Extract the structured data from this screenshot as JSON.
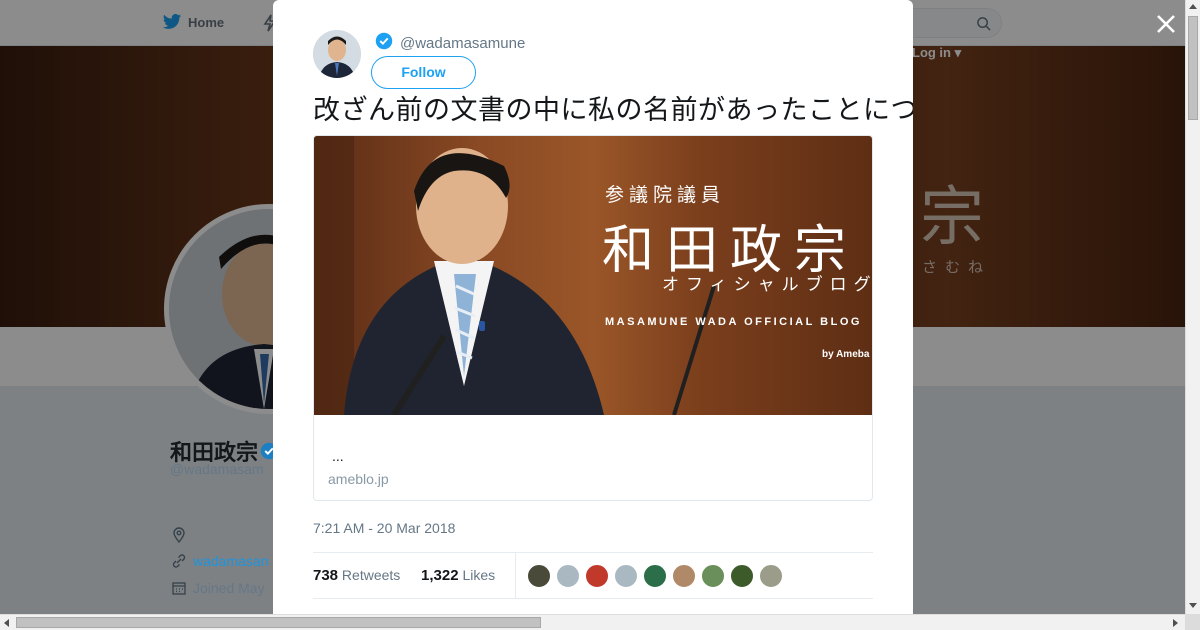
{
  "background": {
    "nav": {
      "home_label": "Home",
      "login_label": "Log in"
    },
    "banner": {
      "kanji": "宗",
      "kana": "さむね"
    },
    "profile": {
      "name": "和田政宗",
      "handle": "@wadamasam",
      "link": "wadamasan",
      "joined": "Joined May"
    }
  },
  "tweet": {
    "handle": "@wadamasamune",
    "follow_label": "Follow",
    "text": "改ざん前の文書の中に私の名前があったことについて、ブログにまとめました。是非ご覧ください。改ざん前の文書の中に私の名前があったことについて",
    "card": {
      "image_title_small": "参議院議員",
      "image_title_big": "和田政宗",
      "image_subtitle": "オフィシャルブログ",
      "image_english": "MASAMUNE WADA OFFICIAL BLOG",
      "image_by": "by Ameba",
      "description": "...",
      "domain": "ameblo.jp"
    },
    "timestamp": "7:21 AM - 20 Mar 2018",
    "retweets": {
      "count": "738",
      "label": "Retweets"
    },
    "likes": {
      "count": "1,322",
      "label": "Likes"
    },
    "likers": [
      "#4a4a3a",
      "#aab8c2",
      "#c0392b",
      "#aab8c2",
      "#2c6e49",
      "#b08968",
      "#6a8f5a",
      "#3d5a2a",
      "#9c9c8a"
    ]
  },
  "colors": {
    "accent": "#1da1f2",
    "verified": "#1da1f2",
    "muted": "#657786"
  }
}
